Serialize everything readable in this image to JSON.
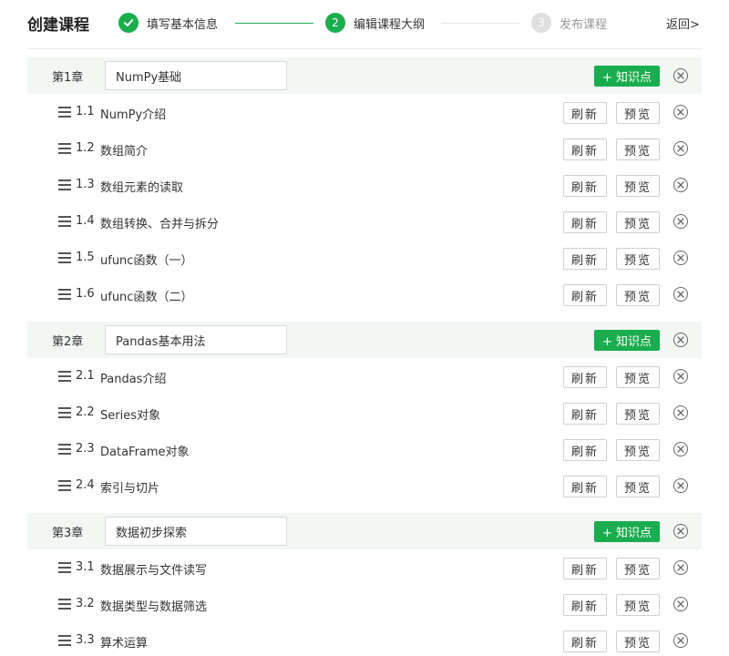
{
  "header": {
    "title": "创建课程",
    "back_label": "返回>",
    "steps": [
      {
        "number": "✓",
        "label": "填写基本信息",
        "state": "done"
      },
      {
        "number": "2",
        "label": "编辑课程大纲",
        "state": "active"
      },
      {
        "number": "3",
        "label": "发布课程",
        "state": "pending"
      }
    ]
  },
  "labels": {
    "add_knowledge_point": "+ 知识点",
    "refresh": "刷新",
    "preview": "预览"
  },
  "colors": {
    "accent": "#1aad4f",
    "chapter_bg": "#f3f7f4",
    "pending_step": "#e0e0e0"
  },
  "chapters": [
    {
      "label": "第1章",
      "title": "NumPy基础",
      "lessons": [
        {
          "num": "1.1",
          "title": "NumPy介绍"
        },
        {
          "num": "1.2",
          "title": "数组简介"
        },
        {
          "num": "1.3",
          "title": "数组元素的读取"
        },
        {
          "num": "1.4",
          "title": "数组转换、合并与拆分"
        },
        {
          "num": "1.5",
          "title": "ufunc函数（一）"
        },
        {
          "num": "1.6",
          "title": "ufunc函数（二）"
        }
      ]
    },
    {
      "label": "第2章",
      "title": "Pandas基本用法",
      "lessons": [
        {
          "num": "2.1",
          "title": "Pandas介绍"
        },
        {
          "num": "2.2",
          "title": "Series对象"
        },
        {
          "num": "2.3",
          "title": "DataFrame对象"
        },
        {
          "num": "2.4",
          "title": "索引与切片"
        }
      ]
    },
    {
      "label": "第3章",
      "title": "数据初步探索",
      "lessons": [
        {
          "num": "3.1",
          "title": "数据展示与文件读写"
        },
        {
          "num": "3.2",
          "title": "数据类型与数据筛选"
        },
        {
          "num": "3.3",
          "title": "算术运算"
        }
      ]
    }
  ]
}
